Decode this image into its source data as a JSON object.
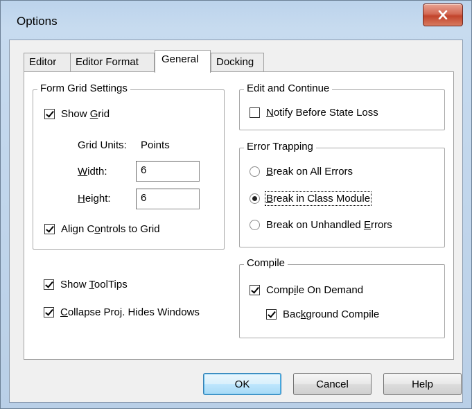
{
  "window": {
    "title": "Options",
    "close_label": "X"
  },
  "tabs": [
    {
      "label": "Editor",
      "active": false
    },
    {
      "label": "Editor Format",
      "active": false
    },
    {
      "label": "General",
      "active": true
    },
    {
      "label": "Docking",
      "active": false
    }
  ],
  "form_grid": {
    "legend": "Form Grid Settings",
    "show_grid": {
      "pre": "Show ",
      "key": "G",
      "post": "rid",
      "checked": true
    },
    "grid_units_label": "Grid Units:",
    "grid_units_value": "Points",
    "width": {
      "key": "W",
      "post": "idth:",
      "value": "6"
    },
    "height": {
      "key": "H",
      "post": "eight:",
      "value": "6"
    },
    "align": {
      "pre": "Align C",
      "key": "o",
      "post": "ntrols to Grid",
      "checked": true
    }
  },
  "tooltips": {
    "pre": "Show ",
    "key": "T",
    "post": "oolTips",
    "checked": true
  },
  "collapse": {
    "pre": "",
    "key": "C",
    "post": "ollapse Proj. Hides Windows",
    "checked": true
  },
  "edit_continue": {
    "legend": "Edit and Continue",
    "notify": {
      "pre": "",
      "key": "N",
      "post": "otify Before State Loss",
      "checked": false
    }
  },
  "error_trapping": {
    "legend": "Error Trapping",
    "options": [
      {
        "pre": "",
        "key": "B",
        "post": "reak on All Errors",
        "selected": false
      },
      {
        "pre": "",
        "key": "B",
        "post": "reak in Class Module",
        "selected": true
      },
      {
        "pre": "Break on Unhandled ",
        "key": "E",
        "post": "rrors",
        "selected": false
      }
    ]
  },
  "compile": {
    "legend": "Compile",
    "on_demand": {
      "pre": "Comp",
      "key": "i",
      "post": "le On Demand",
      "checked": true
    },
    "background": {
      "pre": "Bac",
      "key": "k",
      "post": "ground Compile",
      "checked": true
    }
  },
  "buttons": {
    "ok": "OK",
    "cancel": "Cancel",
    "help": "Help"
  }
}
